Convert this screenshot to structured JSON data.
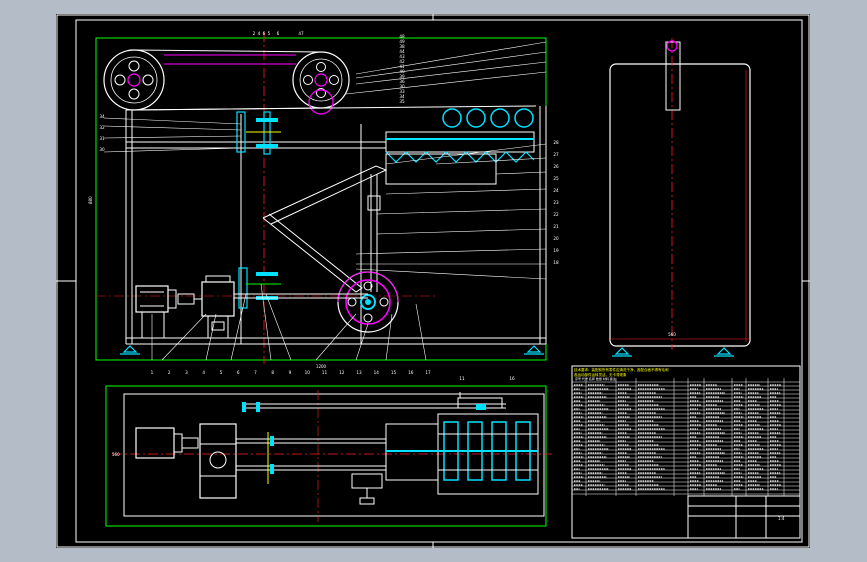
{
  "drawing": {
    "title_block_scale": "1:4",
    "dimensions": {
      "overall_height": "880",
      "overall_width": "1200",
      "plan_depth": "560",
      "side_width": "560"
    },
    "balloons": {
      "front_top": [
        "2",
        "4",
        "6",
        "5",
        "6",
        "47",
        "48",
        "49",
        "38",
        "44",
        "43",
        "42",
        "41",
        "40",
        "39",
        "36",
        "30",
        "33",
        "34",
        "35"
      ],
      "front_left": [
        "34",
        "32",
        "31",
        "30"
      ],
      "front_right": [
        "28",
        "27",
        "26",
        "25",
        "24",
        "23",
        "22",
        "21",
        "20",
        "19",
        "18"
      ],
      "front_bottom": [
        "1",
        "2",
        "3",
        "4",
        "5",
        "6",
        "7",
        "8",
        "9",
        "10",
        "11",
        "12",
        "13",
        "14",
        "15",
        "16",
        "17"
      ],
      "plan": [
        "11",
        "16"
      ]
    },
    "bom_header": "序号  代号  名称  数量  材料  备注",
    "notes_line1": "技术要求：装配前所有零件应清洗干净，各配合面不得有毛刺",
    "notes_line2": "各运动部件运转灵活，无卡滞现象"
  },
  "colors": {
    "background": "#b4bcc8",
    "sheet": "#000000",
    "outline": "#ffffff",
    "frame": "#00ff00",
    "center": "#ff2020",
    "accent": "#ff00ff",
    "cyan": "#00e0ff",
    "yellow": "#ffff00"
  }
}
